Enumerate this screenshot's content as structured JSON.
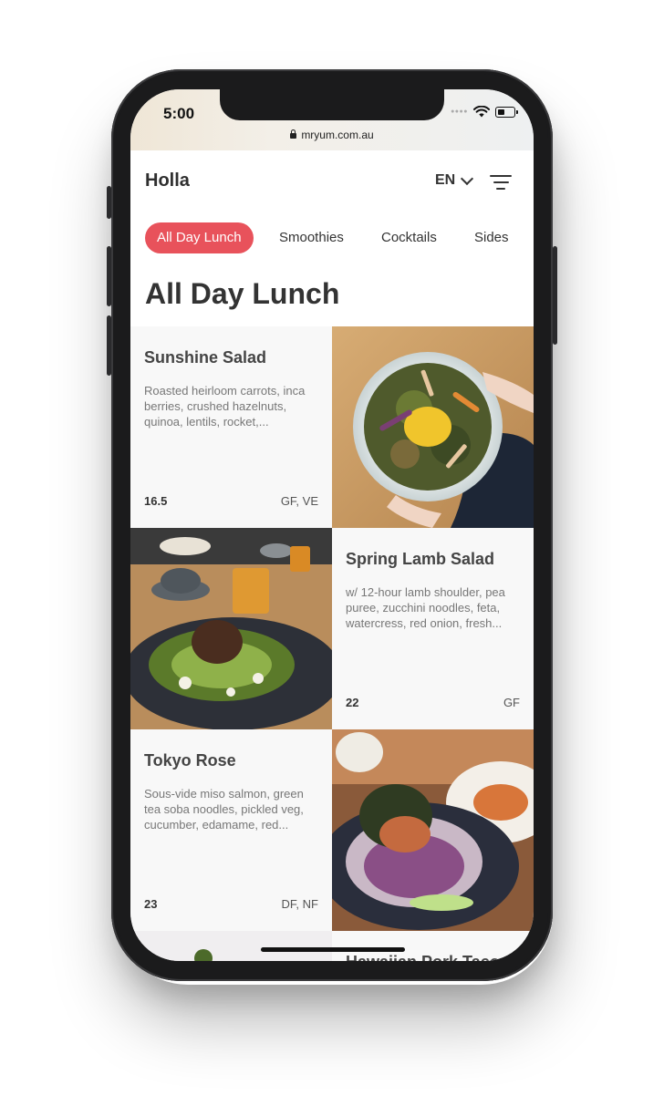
{
  "status_bar": {
    "time": "5:00"
  },
  "browser": {
    "url": "mryum.com.au"
  },
  "header": {
    "brand": "Holla",
    "language": "EN"
  },
  "tabs": [
    {
      "label": "All Day Lunch",
      "active": true
    },
    {
      "label": "Smoothies",
      "active": false
    },
    {
      "label": "Cocktails",
      "active": false
    },
    {
      "label": "Sides",
      "active": false
    }
  ],
  "section": {
    "title": "All Day Lunch"
  },
  "menu_items": [
    {
      "name": "Sunshine Salad",
      "description": "Roasted heirloom carrots, inca berries, crushed hazelnuts, quinoa, lentils, rocket,...",
      "price": "16.5",
      "tags": "GF, VE",
      "image": "salad-bowl-photo"
    },
    {
      "name": "Spring Lamb Salad",
      "description": "w/ 12-hour lamb shoulder, pea puree, zucchini noodles, feta, watercress, red onion, fresh...",
      "price": "22",
      "tags": "GF",
      "image": "lamb-salad-photo"
    },
    {
      "name": "Tokyo Rose",
      "description": "Sous-vide miso salmon, green tea soba noodles, pickled veg, cucumber, edamame, red...",
      "price": "23",
      "tags": "DF, NF",
      "image": "salmon-noodle-photo"
    },
    {
      "name": "Hawaiian Pork Taco",
      "image": "partial-photo"
    }
  ],
  "colors": {
    "accent": "#e8525b",
    "text": "#333333",
    "card": "#f8f8f8"
  },
  "icons": [
    "lock-icon",
    "wifi-icon",
    "battery-icon",
    "signal-icon",
    "chevron-down-icon",
    "filter-icon"
  ]
}
